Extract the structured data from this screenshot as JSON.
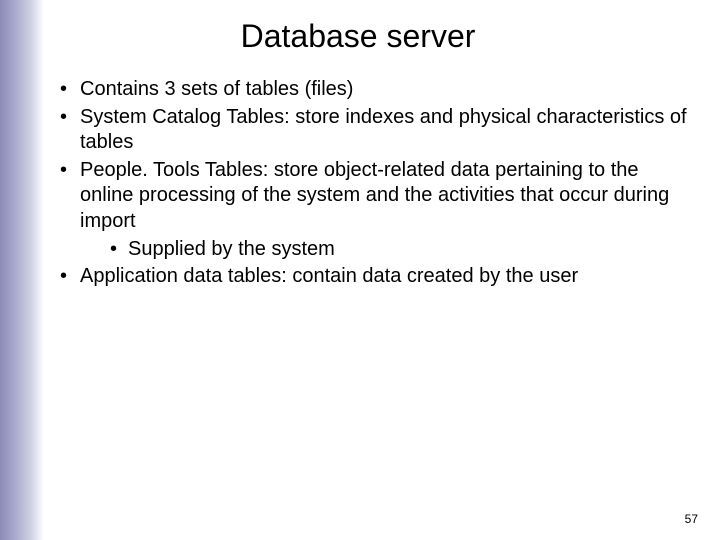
{
  "title": "Database server",
  "bullets": [
    {
      "text": "Contains 3 sets of tables (files)"
    },
    {
      "text": "System Catalog Tables:  store indexes and physical characteristics of tables"
    },
    {
      "text": "People. Tools Tables:  store object-related data pertaining to the online processing of the system and the activities that occur during import",
      "sub": [
        {
          "text": "Supplied by the system"
        }
      ]
    },
    {
      "text": "Application data tables: contain data created by the user"
    }
  ],
  "pageNumber": "57"
}
